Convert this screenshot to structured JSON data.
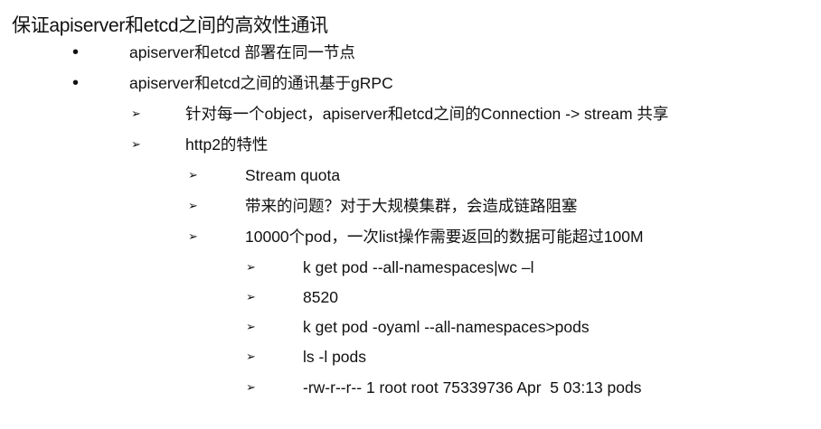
{
  "slide": {
    "title": "保证apiserver和etcd之间的高效性通讯",
    "items": [
      {
        "level": 1,
        "marker": "•",
        "text": "apiserver和etcd 部署在同一节点"
      },
      {
        "level": 1,
        "marker": "•",
        "text": "apiserver和etcd之间的通讯基于gRPC"
      },
      {
        "level": 2,
        "marker": "➢",
        "text": "针对每一个object，apiserver和etcd之间的Connection -> stream 共享"
      },
      {
        "level": 2,
        "marker": "➢",
        "text": "http2的特性"
      },
      {
        "level": 3,
        "marker": "➢",
        "text": "Stream quota"
      },
      {
        "level": 3,
        "marker": "➢",
        "text": "带来的问题？对于大规模集群，会造成链路阻塞"
      },
      {
        "level": 3,
        "marker": "➢",
        "text": "10000个pod，一次list操作需要返回的数据可能超过100M"
      },
      {
        "level": 4,
        "marker": "➢",
        "text": "k get pod --all-namespaces|wc –l"
      },
      {
        "level": 4,
        "marker": "➢",
        "text": "8520"
      },
      {
        "level": 4,
        "marker": "➢",
        "text": "k get pod -oyaml --all-namespaces>pods"
      },
      {
        "level": 4,
        "marker": "➢",
        "text": "ls -l pods"
      },
      {
        "level": 4,
        "marker": "➢",
        "text": "-rw-r--r-- 1 root root 75339736 Apr  5 03:13 pods"
      }
    ]
  }
}
